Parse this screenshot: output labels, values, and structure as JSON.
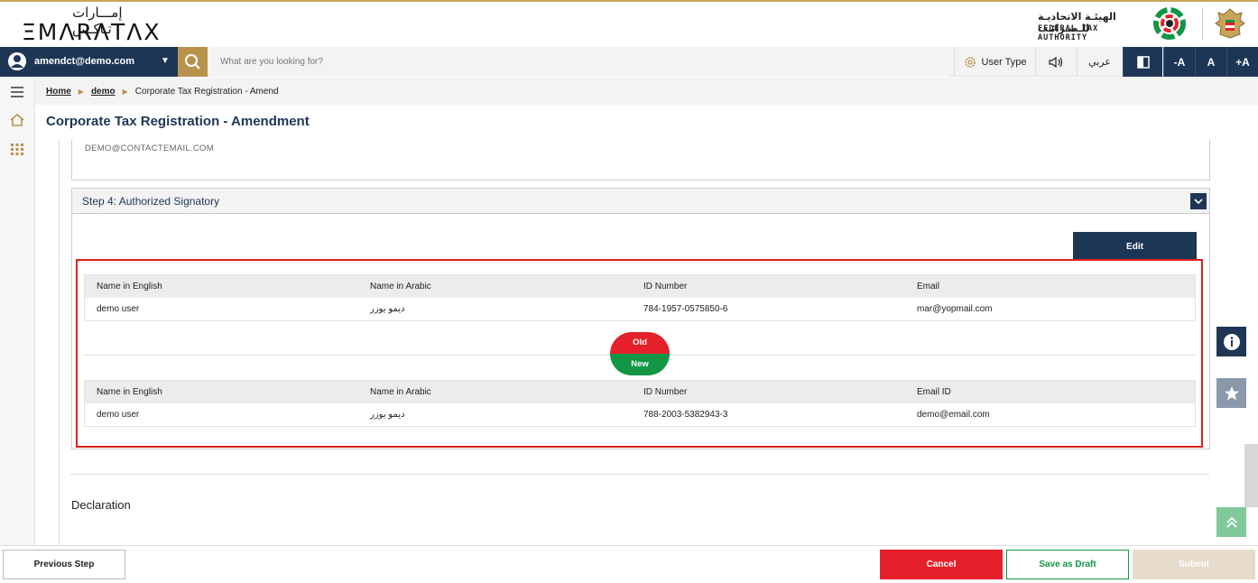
{
  "brand": {
    "logo_ar": "إمـــارات تـاكـس",
    "logo_en": "ΞMΛRΛTΛX",
    "fta_ar": "الهيئـة الاتحاديـة للـضـرائـب",
    "fta_en": "FEDERAL TAX AUTHORITY"
  },
  "navbar": {
    "user": "amendct@demo.com",
    "search_placeholder": "What are you looking for?",
    "user_type": "User Type",
    "arabic": "عربي",
    "font_minus": "-A",
    "font_normal": "A",
    "font_plus": "+A"
  },
  "breadcrumb": {
    "home": "Home",
    "demo": "demo",
    "current": "Corporate Tax Registration - Amend"
  },
  "page": {
    "title": "Corporate Tax Registration - Amendment",
    "prev_email": "DEMO@CONTACTEMAIL.COM"
  },
  "step": {
    "title": "Step 4: Authorized Signatory",
    "edit_label": "Edit"
  },
  "old_table": {
    "headers": [
      "Name in English",
      "Name in Arabic",
      "ID Number",
      "Email"
    ],
    "row": [
      "demo user",
      "ديمو يوزر",
      "784-1957-0575850-6",
      "mar@yopmail.com"
    ]
  },
  "compare": {
    "old_label": "Old",
    "new_label": "New"
  },
  "new_table": {
    "headers": [
      "Name in English",
      "Name in Arabic",
      "ID Number",
      "Email ID"
    ],
    "row": [
      "demo user",
      "ديمو يوزر",
      "788-2003-5382943-3",
      "demo@email.com"
    ]
  },
  "declaration": "Declaration",
  "footer": {
    "previous": "Previous Step",
    "cancel": "Cancel",
    "draft": "Save as Draft",
    "submit": "Submit"
  },
  "colors": {
    "navy": "#1e3655",
    "gold": "#b8924c",
    "red": "#e5202a",
    "green": "#129645",
    "highlight": "#e02020"
  },
  "icons": [
    "user-avatar-icon",
    "search-icon",
    "gear-icon",
    "speaker-icon",
    "contrast-icon",
    "menu-icon",
    "home-icon",
    "grid-icon",
    "chevron-down-icon",
    "info-icon",
    "star-icon",
    "double-chevron-up-icon"
  ]
}
